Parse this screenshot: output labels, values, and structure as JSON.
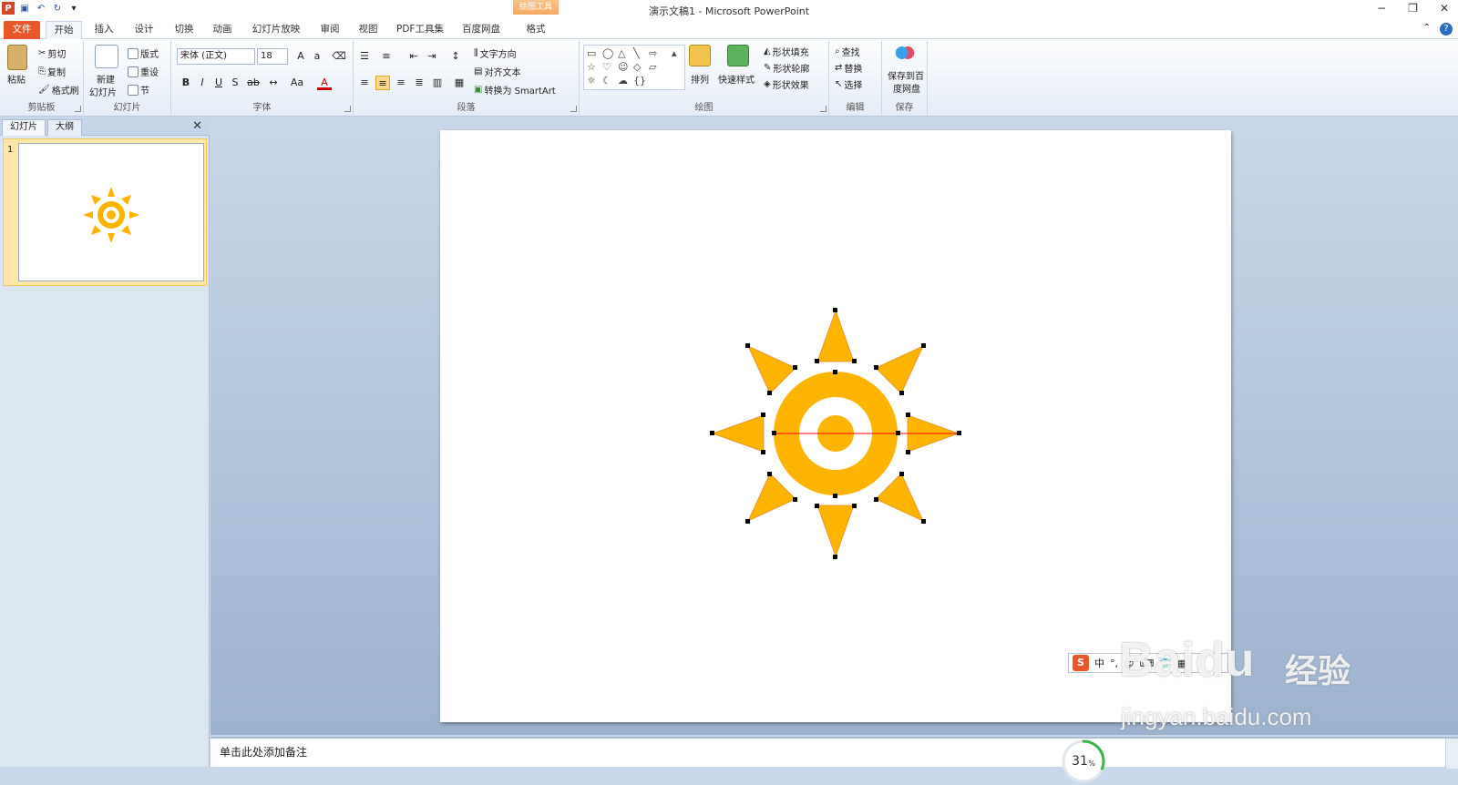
{
  "window": {
    "title": "演示文稿1 - Microsoft PowerPoint",
    "context_tab_group": "绘图工具"
  },
  "tabs": [
    "文件",
    "开始",
    "插入",
    "设计",
    "切换",
    "动画",
    "幻灯片放映",
    "审阅",
    "视图",
    "PDF工具集",
    "百度网盘",
    "格式"
  ],
  "ribbon": {
    "clipboard": {
      "label": "剪贴板",
      "paste": "粘贴",
      "cut": "剪切",
      "copy": "复制",
      "format_painter": "格式刷"
    },
    "slides": {
      "label": "幻灯片",
      "new_slide": "新建",
      "new_slide2": "幻灯片",
      "layout": "版式",
      "reset": "重设",
      "section": "节"
    },
    "font": {
      "label": "字体",
      "font_name": "宋体 (正文)",
      "font_size": "18"
    },
    "paragraph": {
      "label": "段落",
      "text_direction": "文字方向",
      "align_text": "对齐文本",
      "smartart": "转换为 SmartArt"
    },
    "drawing": {
      "label": "绘图",
      "arrange": "排列",
      "quick_styles": "快速样式",
      "shape_fill": "形状填充",
      "shape_outline": "形状轮廓",
      "shape_effects": "形状效果"
    },
    "editing": {
      "label": "编辑",
      "find": "查找",
      "replace": "替换",
      "select": "选择"
    },
    "save": {
      "label": "保存",
      "save_to_baidu": "保存到百",
      "save_to_baidu2": "度网盘"
    }
  },
  "left_pane": {
    "tab_slides": "幻灯片",
    "tab_outline": "大纲",
    "slide_number": "1"
  },
  "notes": {
    "placeholder": "单击此处添加备注"
  },
  "progress": {
    "value": "31",
    "unit": "%",
    "percent": 31
  },
  "ime": {
    "label": "中"
  },
  "watermark": {
    "brand": "Baidu",
    "brand2": "经验",
    "url": "jingyan.baidu.com"
  },
  "colors": {
    "sun": "#ffb400",
    "accent": "#e8562a",
    "selection_line": "#ff0000"
  }
}
